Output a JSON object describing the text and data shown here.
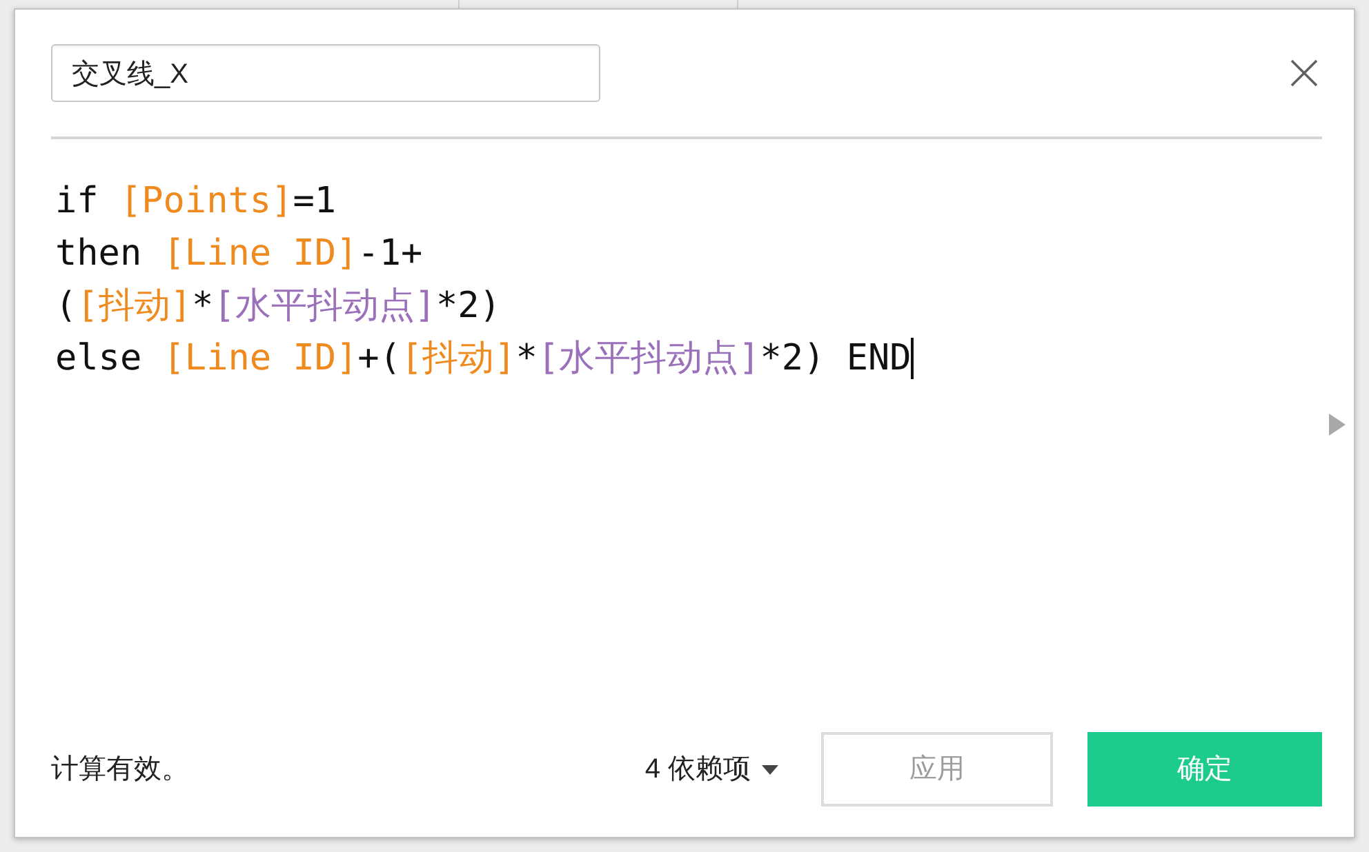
{
  "name_field": {
    "value": "交叉线_X"
  },
  "formula": {
    "lines": [
      {
        "segments": [
          {
            "kind": "plain",
            "text": "if "
          },
          {
            "kind": "field",
            "text": "[Points]"
          },
          {
            "kind": "plain",
            "text": "=1"
          }
        ]
      },
      {
        "segments": [
          {
            "kind": "plain",
            "text": "then "
          },
          {
            "kind": "field",
            "text": "[Line ID]"
          },
          {
            "kind": "plain",
            "text": "-1+"
          }
        ]
      },
      {
        "segments": [
          {
            "kind": "plain",
            "text": "("
          },
          {
            "kind": "field",
            "text": "[抖动]"
          },
          {
            "kind": "plain",
            "text": "*"
          },
          {
            "kind": "parameter",
            "text": "[水平抖动点]"
          },
          {
            "kind": "plain",
            "text": "*2)"
          }
        ]
      },
      {
        "segments": [
          {
            "kind": "plain",
            "text": "else "
          },
          {
            "kind": "field",
            "text": "[Line ID]"
          },
          {
            "kind": "plain",
            "text": "+("
          },
          {
            "kind": "field",
            "text": "[抖动]"
          },
          {
            "kind": "plain",
            "text": "*"
          },
          {
            "kind": "parameter",
            "text": "[水平抖动点]"
          },
          {
            "kind": "plain",
            "text": "*2) END"
          }
        ]
      }
    ],
    "cursor_at_end": true
  },
  "status": "计算有效。",
  "dependencies": {
    "label": "4 依赖项"
  },
  "buttons": [
    {
      "label": "应用",
      "kind": "secondary",
      "disabled": true
    },
    {
      "label": "确定",
      "kind": "primary",
      "disabled": false
    }
  ]
}
